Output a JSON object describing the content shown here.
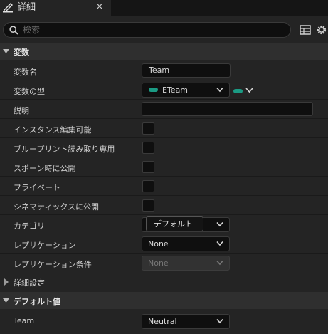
{
  "tab": {
    "title": "詳細",
    "close": "×",
    "icon": "pencil-icon"
  },
  "search": {
    "placeholder": "検索",
    "icon": "search-icon"
  },
  "toolbar": {
    "table_icon": "table-view-icon",
    "settings_icon": "gear-icon"
  },
  "sections": {
    "variable": "変数",
    "advanced": "詳細設定",
    "default_value": "デフォルト値"
  },
  "props": {
    "var_name": {
      "label": "変数名",
      "value": "Team"
    },
    "var_type": {
      "label": "変数の型",
      "value": "ETeam",
      "type_color": "#1b9b84"
    },
    "desc": {
      "label": "説明",
      "value": ""
    },
    "instance_editable": {
      "label": "インスタンス編集可能",
      "checked": false
    },
    "bp_readonly": {
      "label": "ブループリント読み取り専用",
      "checked": false
    },
    "expose_spawn": {
      "label": "スポーン時に公開",
      "checked": false
    },
    "private": {
      "label": "プライベート",
      "checked": false
    },
    "cinematics": {
      "label": "シネマティックスに公開",
      "checked": false
    },
    "category": {
      "label": "カテゴリ",
      "tooltip": "デフォルト"
    },
    "replication": {
      "label": "レプリケーション",
      "value": "None"
    },
    "rep_condition": {
      "label": "レプリケーション条件",
      "value": "None"
    },
    "team": {
      "label": "Team",
      "value": "Neutral"
    }
  },
  "colors": {
    "accent": "#1b9b84",
    "background": "#242424",
    "section": "#2f2f2f",
    "field": "#0f0f0f"
  }
}
